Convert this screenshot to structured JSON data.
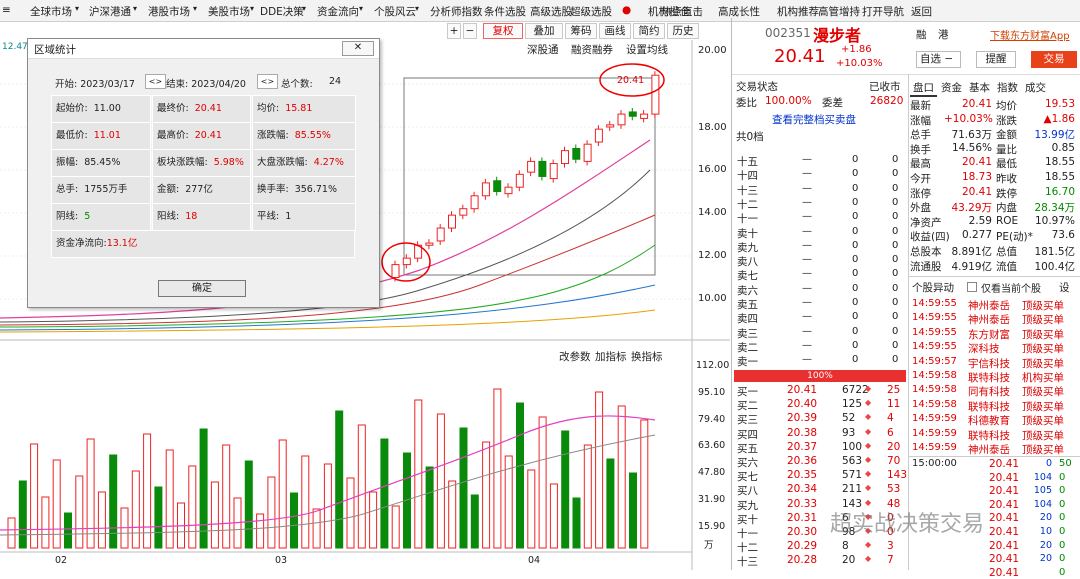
{
  "menu": [
    "≡",
    "全球市场",
    "▾",
    "沪深港通",
    "▾",
    "港股市场",
    "▾",
    "美股市场",
    "▾",
    "DDE决策",
    "▾",
    "资金流向",
    "▾",
    "个股风云",
    "▾",
    "分析师指数",
    "条件选股",
    "高级选股",
    "超级选股",
    "●",
    "机构橙仓",
    "热点直击",
    "高成长性",
    "机构推荐",
    "高管增持",
    "打开导航",
    "返回"
  ],
  "toolbar": {
    "plus": "+",
    "minus": "−",
    "fuquan": "复权",
    "diejia": "叠加",
    "chouma": "筹码",
    "tuoxian": "画线",
    "jianjie": "简约",
    "lishi": "历史"
  },
  "chart_header": {
    "left_num": "12.47",
    "tabs": [
      "深股通",
      "融资融券",
      "设置均线"
    ]
  },
  "stock": {
    "code": "002351",
    "name": "漫步者",
    "price": "20.41",
    "change": "+1.86",
    "pct": "+10.03%",
    "rong": "融",
    "gang": "港",
    "zixuan": "自选",
    "tixing": "提醒",
    "jiaoyi": "交易",
    "download": "下载东方财富App"
  },
  "dialog": {
    "title": "区域统计",
    "start": "开始: 2023/03/17",
    "end": "结束: 2023/04/20",
    "total_label": "总个数:",
    "total": "24",
    "rows": [
      [
        {
          "l": "起始价:",
          "v": "11.00",
          "c": "k"
        },
        {
          "l": "最终价:",
          "v": "20.41",
          "c": "r"
        },
        {
          "l": "均价:",
          "v": "15.81",
          "c": "r"
        }
      ],
      [
        {
          "l": "最低价:",
          "v": "11.01",
          "c": "r"
        },
        {
          "l": "最高价:",
          "v": "20.41",
          "c": "r"
        },
        {
          "l": "涨跌幅:",
          "v": "85.55%",
          "c": "r"
        }
      ],
      [
        {
          "l": "振幅:",
          "v": "85.45%",
          "c": "k"
        },
        {
          "l": "板块涨跌幅:",
          "v": "5.98%",
          "c": "r"
        },
        {
          "l": "大盘涨跌幅:",
          "v": "4.27%",
          "c": "r"
        }
      ],
      [
        {
          "l": "总手:",
          "v": "1755万手",
          "c": "k"
        },
        {
          "l": "金额:",
          "v": "277亿",
          "c": "k"
        },
        {
          "l": "换手率:",
          "v": "356.71%",
          "c": "k"
        }
      ],
      [
        {
          "l": "阴线:",
          "v": "5",
          "c": "g"
        },
        {
          "l": "阳线:",
          "v": "18",
          "c": "r"
        },
        {
          "l": "平线:",
          "v": "1",
          "c": "k"
        }
      ]
    ],
    "flow_label": "资金净流向:",
    "flow": "13.1亿",
    "ok": "确定",
    "close": "✕"
  },
  "chart_price_tag": "20.41",
  "price_axis": [
    "20.00",
    "18.00",
    "16.00",
    "14.00",
    "12.00",
    "10.00"
  ],
  "vol_axis": [
    "112.00",
    "95.10",
    "79.40",
    "63.60",
    "47.80",
    "31.90",
    "15.90",
    "万"
  ],
  "vol_tabs": [
    "改参数",
    "加指标",
    "换指标"
  ],
  "date_labels": [
    "02",
    "03",
    "04"
  ],
  "quote": {
    "jiaoyi": "交易状态",
    "yishou": "已收市",
    "weibi_l": "委比",
    "weibi": "100.00%",
    "weicha_l": "委差",
    "weicha": "26820",
    "full": "查看完整档买卖盘",
    "g0": "共0档",
    "sells": [
      "十五",
      "十四",
      "十三",
      "十二",
      "十一",
      "卖十",
      "卖九",
      "卖八",
      "卖七",
      "卖六",
      "卖五",
      "卖四",
      "卖三",
      "卖二",
      "卖一"
    ],
    "bar": "100%",
    "buys": [
      [
        "买一",
        "20.41",
        "6722",
        "25"
      ],
      [
        "买二",
        "20.40",
        "125",
        "11"
      ],
      [
        "买三",
        "20.39",
        "52",
        "4"
      ],
      [
        "买四",
        "20.38",
        "93",
        "6"
      ],
      [
        "买五",
        "20.37",
        "100",
        "20"
      ],
      [
        "买六",
        "20.36",
        "563",
        "70"
      ],
      [
        "买七",
        "20.35",
        "571",
        "143"
      ],
      [
        "买八",
        "20.34",
        "211",
        "53"
      ],
      [
        "买九",
        "20.33",
        "143",
        "48"
      ],
      [
        "买十",
        "20.31",
        "6",
        "0"
      ],
      [
        "十一",
        "20.30",
        "98",
        "0"
      ],
      [
        "十二",
        "20.29",
        "8",
        "3"
      ],
      [
        "十三",
        "20.28",
        "20",
        "7"
      ]
    ]
  },
  "tabs": [
    "盘口",
    "资金",
    "基本",
    "指数",
    "成交"
  ],
  "stats": [
    [
      "最新",
      "20.41",
      "r",
      "均价",
      "19.53",
      "r"
    ],
    [
      "涨幅",
      "+10.03%",
      "r",
      "涨跌",
      "▲1.86",
      "r"
    ],
    [
      "总手",
      "71.63万",
      "k",
      "金额",
      "13.99亿",
      "b"
    ],
    [
      "换手",
      "14.56%",
      "k",
      "量比",
      "0.85",
      "k"
    ],
    [
      "最高",
      "20.41",
      "r",
      "最低",
      "18.55",
      "k"
    ],
    [
      "今开",
      "18.73",
      "r",
      "昨收",
      "18.55",
      "k"
    ],
    [
      "涨停",
      "20.41",
      "r",
      "跌停",
      "16.70",
      "g"
    ],
    [
      "外盘",
      "43.29万",
      "r",
      "内盘",
      "28.34万",
      "g"
    ],
    [
      "净资产",
      "2.59",
      "k",
      "ROE",
      "10.97%",
      "k"
    ],
    [
      "收益(四)",
      "0.277",
      "k",
      "PE(动)*",
      "73.6",
      "k"
    ],
    [
      "总股本",
      "8.891亿",
      "k",
      "总值",
      "181.5亿",
      "k"
    ],
    [
      "流通股",
      "4.919亿",
      "k",
      "流值",
      "100.4亿",
      "k"
    ]
  ],
  "yidong": {
    "title": "个股异动",
    "only": "仅看当前个股",
    "set": "设",
    "rows": [
      [
        "14:59:55",
        "神州泰岳",
        "顶级买单"
      ],
      [
        "14:59:55",
        "神州泰岳",
        "顶级买单"
      ],
      [
        "14:59:55",
        "东方财富",
        "顶级买单"
      ],
      [
        "14:59:55",
        "深科技",
        "顶级买单"
      ],
      [
        "14:59:57",
        "宇信科技",
        "顶级买单"
      ],
      [
        "14:59:58",
        "联特科技",
        "机构买单"
      ],
      [
        "14:59:58",
        "同有科技",
        "顶级买单"
      ],
      [
        "14:59:58",
        "联特科技",
        "顶级买单"
      ],
      [
        "14:59:59",
        "科德教育",
        "顶级买单"
      ],
      [
        "14:59:59",
        "联特科技",
        "顶级买单"
      ],
      [
        "14:59:59",
        "神州泰岳",
        "顶级买单"
      ]
    ]
  },
  "ticks": [
    [
      "15:00:00",
      "20.41",
      "0",
      "50"
    ],
    [
      "",
      "20.41",
      "104",
      "0"
    ],
    [
      "",
      "20.41",
      "105",
      "0"
    ],
    [
      "",
      "20.41",
      "104",
      "0"
    ],
    [
      "",
      "20.41",
      "20",
      "0"
    ],
    [
      "",
      "20.41",
      "10",
      "0"
    ],
    [
      "",
      "20.41",
      "20",
      "0"
    ],
    [
      "",
      "20.41",
      "20",
      "0"
    ],
    [
      "",
      "20.41",
      "",
      "0"
    ]
  ],
  "watermark": "超实战决策交易",
  "chart_data": {
    "type": "candlestick",
    "candles_open": [
      11.0,
      11.6,
      11.9,
      12.5,
      12.7,
      13.3,
      13.9,
      14.2,
      14.8,
      15.5,
      14.9,
      15.2,
      15.9,
      16.4,
      15.6,
      16.3,
      17.0,
      16.4,
      17.3,
      18.0,
      18.1,
      18.7,
      18.4,
      18.6
    ],
    "candles_close": [
      11.6,
      11.9,
      12.5,
      12.6,
      13.3,
      13.9,
      14.2,
      14.8,
      15.4,
      15.0,
      15.2,
      15.8,
      16.4,
      15.7,
      16.3,
      16.9,
      16.5,
      17.2,
      17.9,
      18.1,
      18.6,
      18.5,
      18.6,
      20.41
    ]
  }
}
